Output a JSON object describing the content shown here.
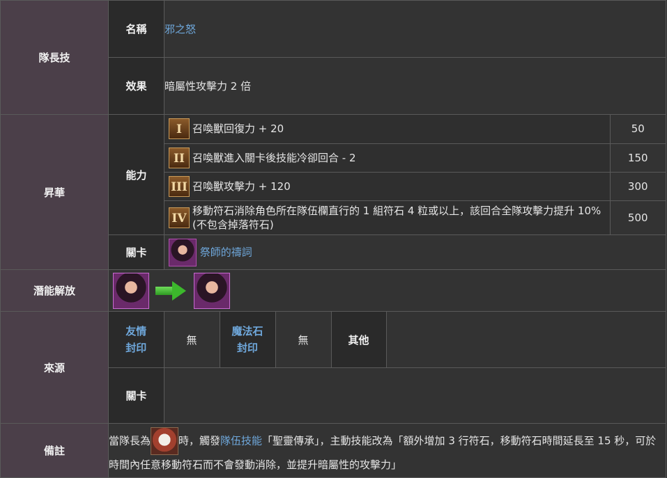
{
  "leader_skill": {
    "header": "隊長技",
    "name_label": "名稱",
    "name": "邪之怒",
    "effect_label": "效果",
    "effect": "暗屬性攻擊力 2 倍"
  },
  "ascension": {
    "header": "昇華",
    "ability_label": "能力",
    "abilities": [
      {
        "tier": "I",
        "text": "召喚獸回復力 + 20",
        "cost": "50"
      },
      {
        "tier": "II",
        "text": "召喚獸進入關卡後技能冷卻回合 - 2",
        "cost": "150"
      },
      {
        "tier": "III",
        "text": "召喚獸攻擊力 + 120",
        "cost": "300"
      },
      {
        "tier": "IV",
        "text": "移動符石消除角色所在隊伍欄直行的 1 組符石 4 粒或以上，該回合全隊攻擊力提升 10% (不包含掉落符石)",
        "cost": "500"
      }
    ],
    "stage_label": "關卡",
    "stage": "祭師的禱詞"
  },
  "potential_release": {
    "header": "潛能解放"
  },
  "source": {
    "header": "來源",
    "friend_seal_line1": "友情",
    "friend_seal_line2": "封印",
    "friend_seal_value": "無",
    "magic_seal_line1": "魔法石",
    "magic_seal_line2": "封印",
    "magic_seal_value": "無",
    "other_label": "其他",
    "stage_label": "關卡"
  },
  "remarks": {
    "header": "備註",
    "prefix": "當隊長為",
    "middle": "時，觸發",
    "link": "隊伍技能",
    "suffix": "「聖靈傳承」，主動技能改為「額外增加 3 行符石，移動符石時間延長至 15 秒，可於時間內任意移動符石而不會發動消除，並提升暗屬性的攻擊力」"
  },
  "colors": {
    "section_header_bg": "#4b3f49",
    "label_bg": "#2a2a2a",
    "cell_bg": "#333333",
    "link": "#6fa8dc",
    "border": "#5a5a5a"
  }
}
